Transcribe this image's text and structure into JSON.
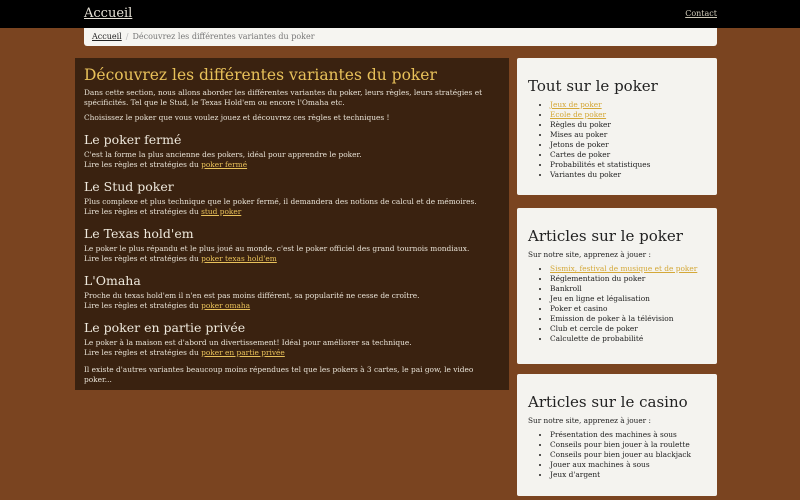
{
  "header": {
    "brand": "Accueil",
    "contact": "Contact"
  },
  "breadcrumb": {
    "home": "Accueil",
    "current": "Découvrez les différentes variantes du poker"
  },
  "main": {
    "title": "Découvrez les différentes variantes du poker",
    "intro": "Dans cette section, nous allons aborder les différentes variantes du poker, leurs règles, leurs stratégies et spécificités. Tel que le Stud, le Texas Hold'em ou encore l'Omaha etc.",
    "intro2": "Choisissez le poker que vous voulez jouez et découvrez ces règles et techniques !",
    "sections": [
      {
        "title": "Le poker fermé",
        "desc": "C'est la forme la plus ancienne des pokers, idéal pour apprendre le poker.",
        "prefix": "Lire les règles et stratégies du",
        "link": "poker fermé"
      },
      {
        "title": "Le Stud poker",
        "desc": "Plus complexe et plus technique que le poker fermé, il demandera des notions de calcul et de mémoires.",
        "prefix": "Lire les règles et stratégies du",
        "link": "stud poker"
      },
      {
        "title": "Le Texas hold'em",
        "desc": "Le poker le plus répandu et le plus joué au monde, c'est le poker officiel des grand tournois mondiaux.",
        "prefix": "Lire les règles et stratégies du",
        "link": "poker texas hold'em"
      },
      {
        "title": "L'Omaha",
        "desc": "Proche du texas hold'em il n'en est pas moins différent, sa popularité ne cesse de croître.",
        "prefix": "Lire les règles et stratégies du",
        "link": "poker omaha"
      },
      {
        "title": "Le poker en partie privée",
        "desc": "Le poker à la maison est d'abord un divertissement! Idéal pour améliorer sa technique.",
        "prefix": "Lire les règles et stratégies du",
        "link": "poker en partie privée"
      }
    ],
    "outro": "Il existe d'autres variantes beaucoup moins répendues tel que les pokers à 3 cartes, le pai gow, le video poker..."
  },
  "side1": {
    "title": "Tout sur le poker",
    "items": [
      "Jeux de poker",
      "Ecole de poker",
      "Règles du poker",
      "Mises au poker",
      "Jetons de poker",
      "Cartes de poker",
      "Probabilités et statistiques",
      "Variantes du poker"
    ]
  },
  "side2": {
    "title": "Articles sur le poker",
    "subtitle": "Sur notre site, apprenez à jouer :",
    "items": [
      "Sismix, festival de musique et de poker",
      "Réglementation du poker",
      "Bankroll",
      "Jeu en ligne et légalisation",
      "Poker et casino",
      "Emission de poker à la télévision",
      "Club et cercle de poker",
      "Calculette de probabilité"
    ]
  },
  "side3": {
    "title": "Articles sur le casino",
    "subtitle": "Sur notre site, apprenez à jouer :",
    "items": [
      "Présentation des machines à sous",
      "Conseils pour bien jouer à la roulette",
      "Conseils pour bien jouer au blackjack",
      "Jouer aux machines à sous",
      "Jeux d'argent"
    ]
  },
  "colors": {
    "background": "#7a4420",
    "main_panel": "#3a2210",
    "accent": "#e8c15a",
    "link_side": "#d4a838"
  }
}
